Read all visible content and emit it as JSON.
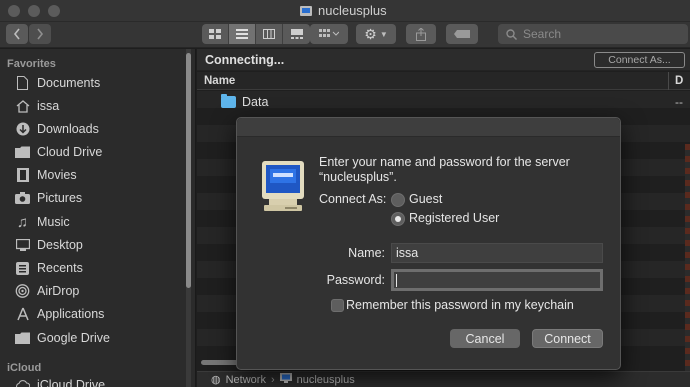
{
  "window": {
    "title": "nucleusplus"
  },
  "toolbar": {
    "search_placeholder": "Search"
  },
  "sidebar": {
    "favorites_header": "Favorites",
    "items": [
      {
        "label": "Documents",
        "icon": "document-icon"
      },
      {
        "label": "issa",
        "icon": "home-icon"
      },
      {
        "label": "Downloads",
        "icon": "downloads-icon"
      },
      {
        "label": "Cloud Drive",
        "icon": "folder-icon"
      },
      {
        "label": "Movies",
        "icon": "film-icon"
      },
      {
        "label": "Pictures",
        "icon": "camera-icon"
      },
      {
        "label": "Music",
        "icon": "music-note-icon"
      },
      {
        "label": "Desktop",
        "icon": "desktop-icon"
      },
      {
        "label": "Recents",
        "icon": "recents-icon"
      },
      {
        "label": "AirDrop",
        "icon": "airdrop-icon"
      },
      {
        "label": "Applications",
        "icon": "applications-icon"
      },
      {
        "label": "Google Drive",
        "icon": "folder-icon"
      }
    ],
    "icloud_header": "iCloud",
    "icloud_items": [
      {
        "label": "iCloud Drive",
        "icon": "cloud-icon"
      }
    ]
  },
  "main": {
    "status": "Connecting...",
    "connect_as_button": "Connect As...",
    "column_name": "Name",
    "column_d": "D",
    "rows": [
      {
        "name": "Data",
        "value": "--"
      }
    ],
    "pathbar": {
      "network": "Network",
      "server": "nucleusplus"
    }
  },
  "dialog": {
    "prompt": "Enter your name and password for the server “nucleusplus”.",
    "connect_as_label": "Connect As:",
    "guest_label": "Guest",
    "registered_label": "Registered User",
    "selected_option": "Registered User",
    "name_label": "Name:",
    "name_value": "issa",
    "password_label": "Password:",
    "password_value": "",
    "remember_label": "Remember this password in my keychain",
    "remember_checked": false,
    "cancel_label": "Cancel",
    "connect_label": "Connect"
  }
}
